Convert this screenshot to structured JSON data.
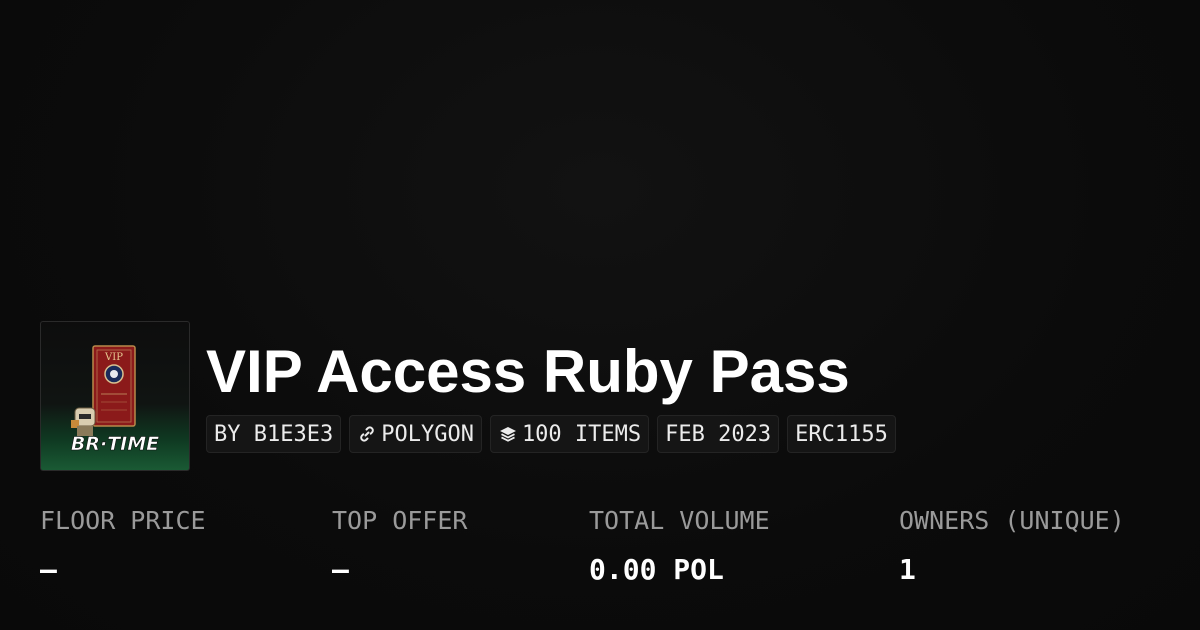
{
  "collection": {
    "title": "VIP Access Ruby Pass",
    "logo_text": "BR·TIME",
    "logo_text_left": "BR",
    "logo_text_right": "TIME"
  },
  "pills": [
    {
      "label": "BY B1E3E3",
      "icon": ""
    },
    {
      "label": "POLYGON",
      "icon": "link-icon"
    },
    {
      "label": "100 ITEMS",
      "icon": "layers-icon"
    },
    {
      "label": "FEB 2023",
      "icon": ""
    },
    {
      "label": "ERC1155",
      "icon": ""
    }
  ],
  "stats": [
    {
      "label": "FLOOR PRICE",
      "value": "–"
    },
    {
      "label": "TOP OFFER",
      "value": "–"
    },
    {
      "label": "TOTAL VOLUME",
      "value": "0.00 POL"
    },
    {
      "label": "OWNERS (UNIQUE)",
      "value": "1"
    }
  ],
  "colors": {
    "background": "#0a0a0a",
    "text": "#ffffff",
    "muted": "#9a9a9a",
    "pill_bg": "#151515",
    "pill_border": "#242424",
    "ruby": "#8b1a1a",
    "green": "#1a5a34"
  }
}
